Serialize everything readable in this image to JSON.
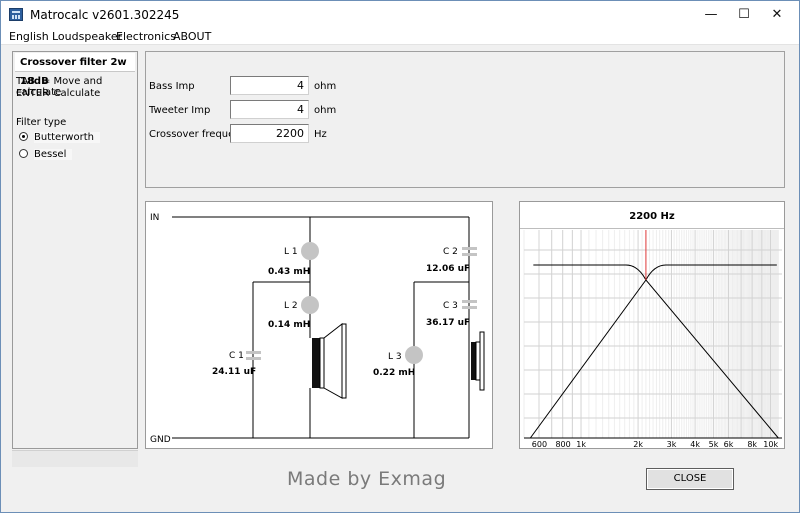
{
  "window": {
    "title": "Matrocalc v2601.302245",
    "minimize": "—",
    "maximize": "☐",
    "close": "✕"
  },
  "menu": [
    "English",
    "Loudspeaker",
    "Electronics",
    "ABOUT"
  ],
  "left_panel": {
    "title": "Crossover filter 2w 18dB",
    "hints": [
      {
        "key": "TAB",
        "text": "= Move and calculate"
      },
      {
        "key": "ENTER",
        "text": "= Calculate"
      }
    ],
    "filter_type_label": "Filter type",
    "filter_options": [
      {
        "label": "Butterworth",
        "selected": true
      },
      {
        "label": "Bessel",
        "selected": false
      }
    ]
  },
  "inputs": [
    {
      "label": "Bass Imp",
      "value": "4",
      "unit": "ohm"
    },
    {
      "label": "Tweeter Imp",
      "value": "4",
      "unit": "ohm"
    },
    {
      "label": "Crossover freque.",
      "value": "2200",
      "unit": "Hz"
    }
  ],
  "schematic": {
    "in_label": "IN",
    "gnd_label": "GND",
    "components": {
      "L1": {
        "name": "L 1",
        "value": "0.43 mH"
      },
      "L2": {
        "name": "L 2",
        "value": "0.14 mH"
      },
      "C1": {
        "name": "C 1",
        "value": "24.11 uF"
      },
      "C2": {
        "name": "C 2",
        "value": "12.06 uF"
      },
      "C3": {
        "name": "C 3",
        "value": "36.17 uF"
      },
      "L3": {
        "name": "L 3",
        "value": "0.22 mH"
      }
    }
  },
  "graph": {
    "title": "2200 Hz",
    "crossover_hz": 2200,
    "x_ticks": [
      "600",
      "800",
      "1k",
      "2k",
      "3k",
      "4k",
      "5k",
      "6k",
      "8k",
      "10k"
    ],
    "marker_color": "#e03a3a"
  },
  "footer": {
    "made_by": "Made by Exmag",
    "close_button": "CLOSE"
  }
}
